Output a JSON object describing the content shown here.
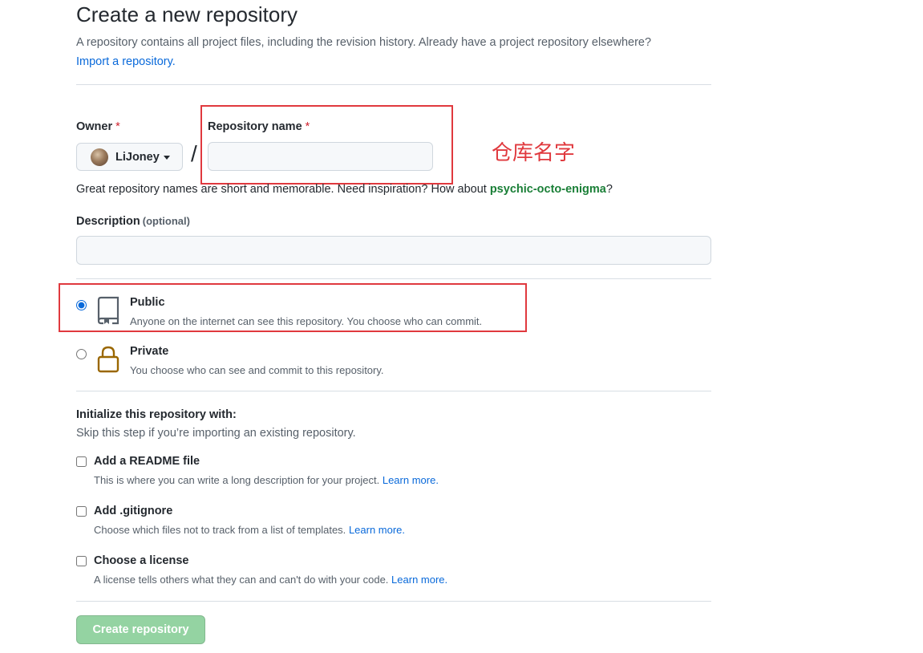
{
  "header": {
    "title": "Create a new repository",
    "intro_text": "A repository contains all project files, including the revision history. Already have a project repository elsewhere?",
    "import_link": "Import a repository."
  },
  "owner": {
    "label": "Owner",
    "required_mark": "*",
    "selected": "LiJoney",
    "separator": "/"
  },
  "repository_name": {
    "label": "Repository name",
    "required_mark": "*",
    "value": "",
    "annotation": "仓库名字"
  },
  "name_hint": {
    "text": "Great repository names are short and memorable. Need inspiration? How about ",
    "suggestion": "psychic-octo-enigma",
    "suffix": "?"
  },
  "description": {
    "label": "Description",
    "optional_label": "(optional)",
    "value": ""
  },
  "visibility": {
    "options": [
      {
        "title": "Public",
        "note": "Anyone on the internet can see this repository. You choose who can commit.",
        "icon": "repo-icon",
        "checked": true
      },
      {
        "title": "Private",
        "note": "You choose who can see and commit to this repository.",
        "icon": "lock-icon",
        "checked": false
      }
    ]
  },
  "initialize": {
    "heading": "Initialize this repository with:",
    "subtext": "Skip this step if you’re importing an existing repository.",
    "options": [
      {
        "title": "Add a README file",
        "note": "This is where you can write a long description for your project.",
        "link": "Learn more.",
        "checked": false
      },
      {
        "title": "Add .gitignore",
        "note": "Choose which files not to track from a list of templates.",
        "link": "Learn more.",
        "checked": false
      },
      {
        "title": "Choose a license",
        "note": "A license tells others what they can and can't do with your code.",
        "link": "Learn more.",
        "checked": false
      }
    ]
  },
  "submit": {
    "label": "Create repository"
  },
  "colors": {
    "link": "#0969da",
    "required": "#cf222e",
    "suggestion": "#1a7f37",
    "annotation": "#e0393e",
    "button_disabled": "#94d3a2",
    "lock_icon": "#9a6700"
  }
}
